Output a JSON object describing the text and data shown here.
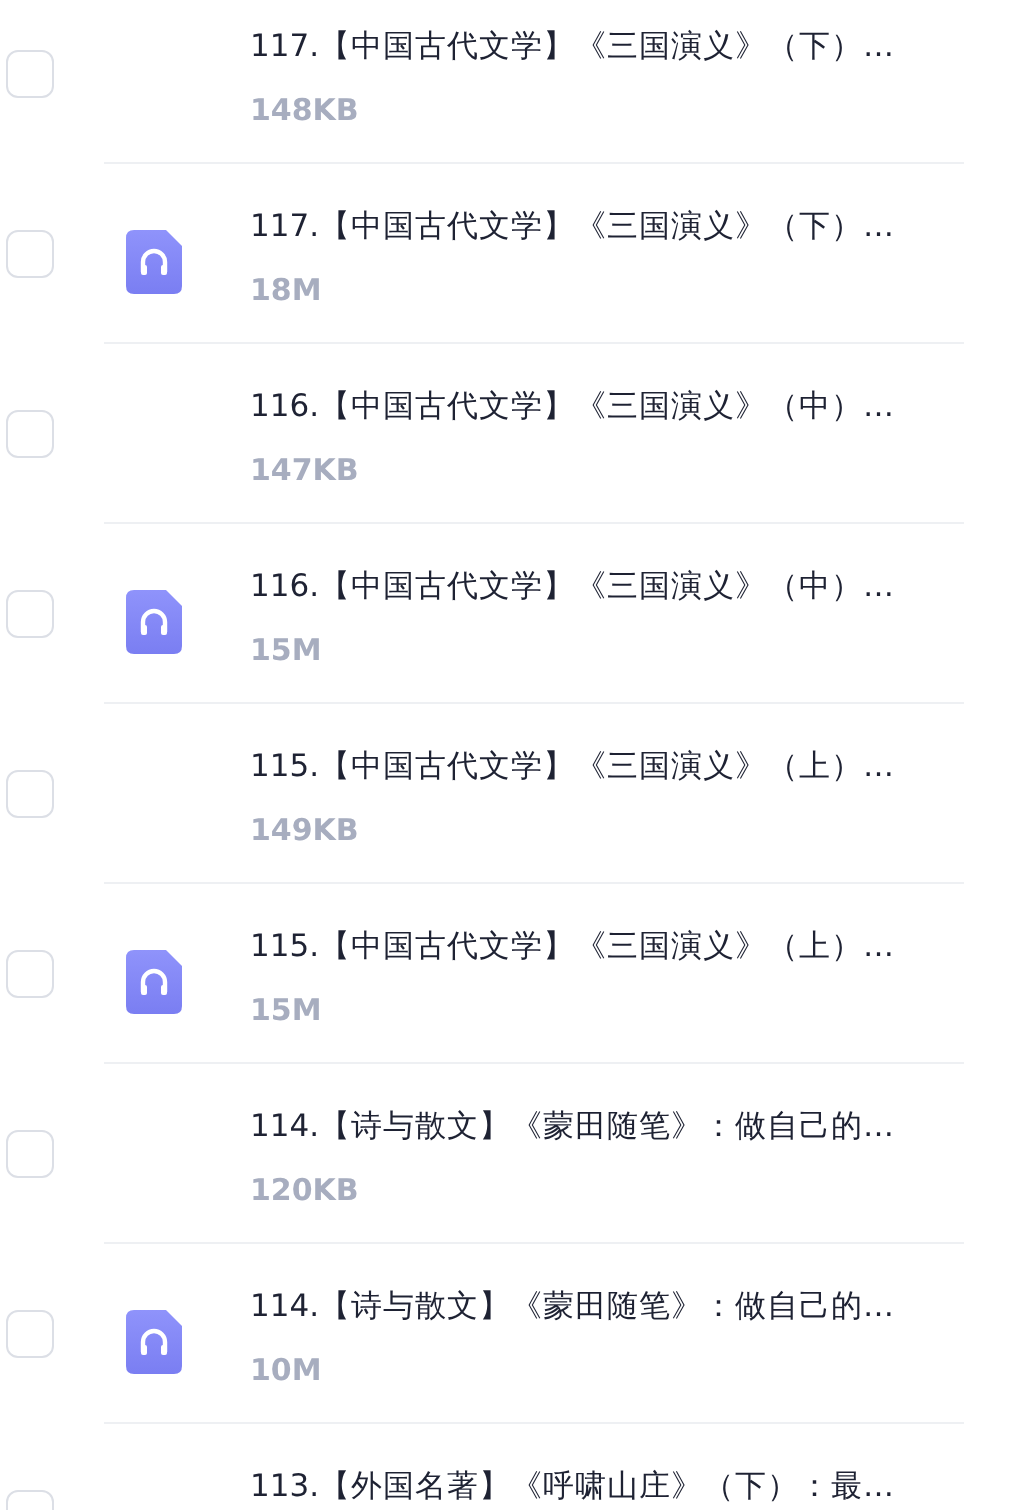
{
  "files": [
    {
      "kind": "plain",
      "title": "117.【中国古代文学】《三国演义》（下）…",
      "size": "148KB",
      "checked": false
    },
    {
      "kind": "audio",
      "title": "117.【中国古代文学】《三国演义》（下）…",
      "size": "18M",
      "checked": false
    },
    {
      "kind": "plain",
      "title": "116.【中国古代文学】《三国演义》（中）…",
      "size": "147KB",
      "checked": false
    },
    {
      "kind": "audio",
      "title": "116.【中国古代文学】《三国演义》（中）…",
      "size": "15M",
      "checked": false
    },
    {
      "kind": "plain",
      "title": "115.【中国古代文学】《三国演义》（上）…",
      "size": "149KB",
      "checked": false
    },
    {
      "kind": "audio",
      "title": "115.【中国古代文学】《三国演义》（上）…",
      "size": "15M",
      "checked": false
    },
    {
      "kind": "plain",
      "title": "114.【诗与散文】《蒙田随笔》：做自己的…",
      "size": "120KB",
      "checked": false
    },
    {
      "kind": "audio",
      "title": "114.【诗与散文】《蒙田随笔》：做自己的…",
      "size": "10M",
      "checked": false
    },
    {
      "kind": "plain",
      "title": "113.【外国名著】《呼啸山庄》（下）：最…",
      "checked": false
    }
  ]
}
